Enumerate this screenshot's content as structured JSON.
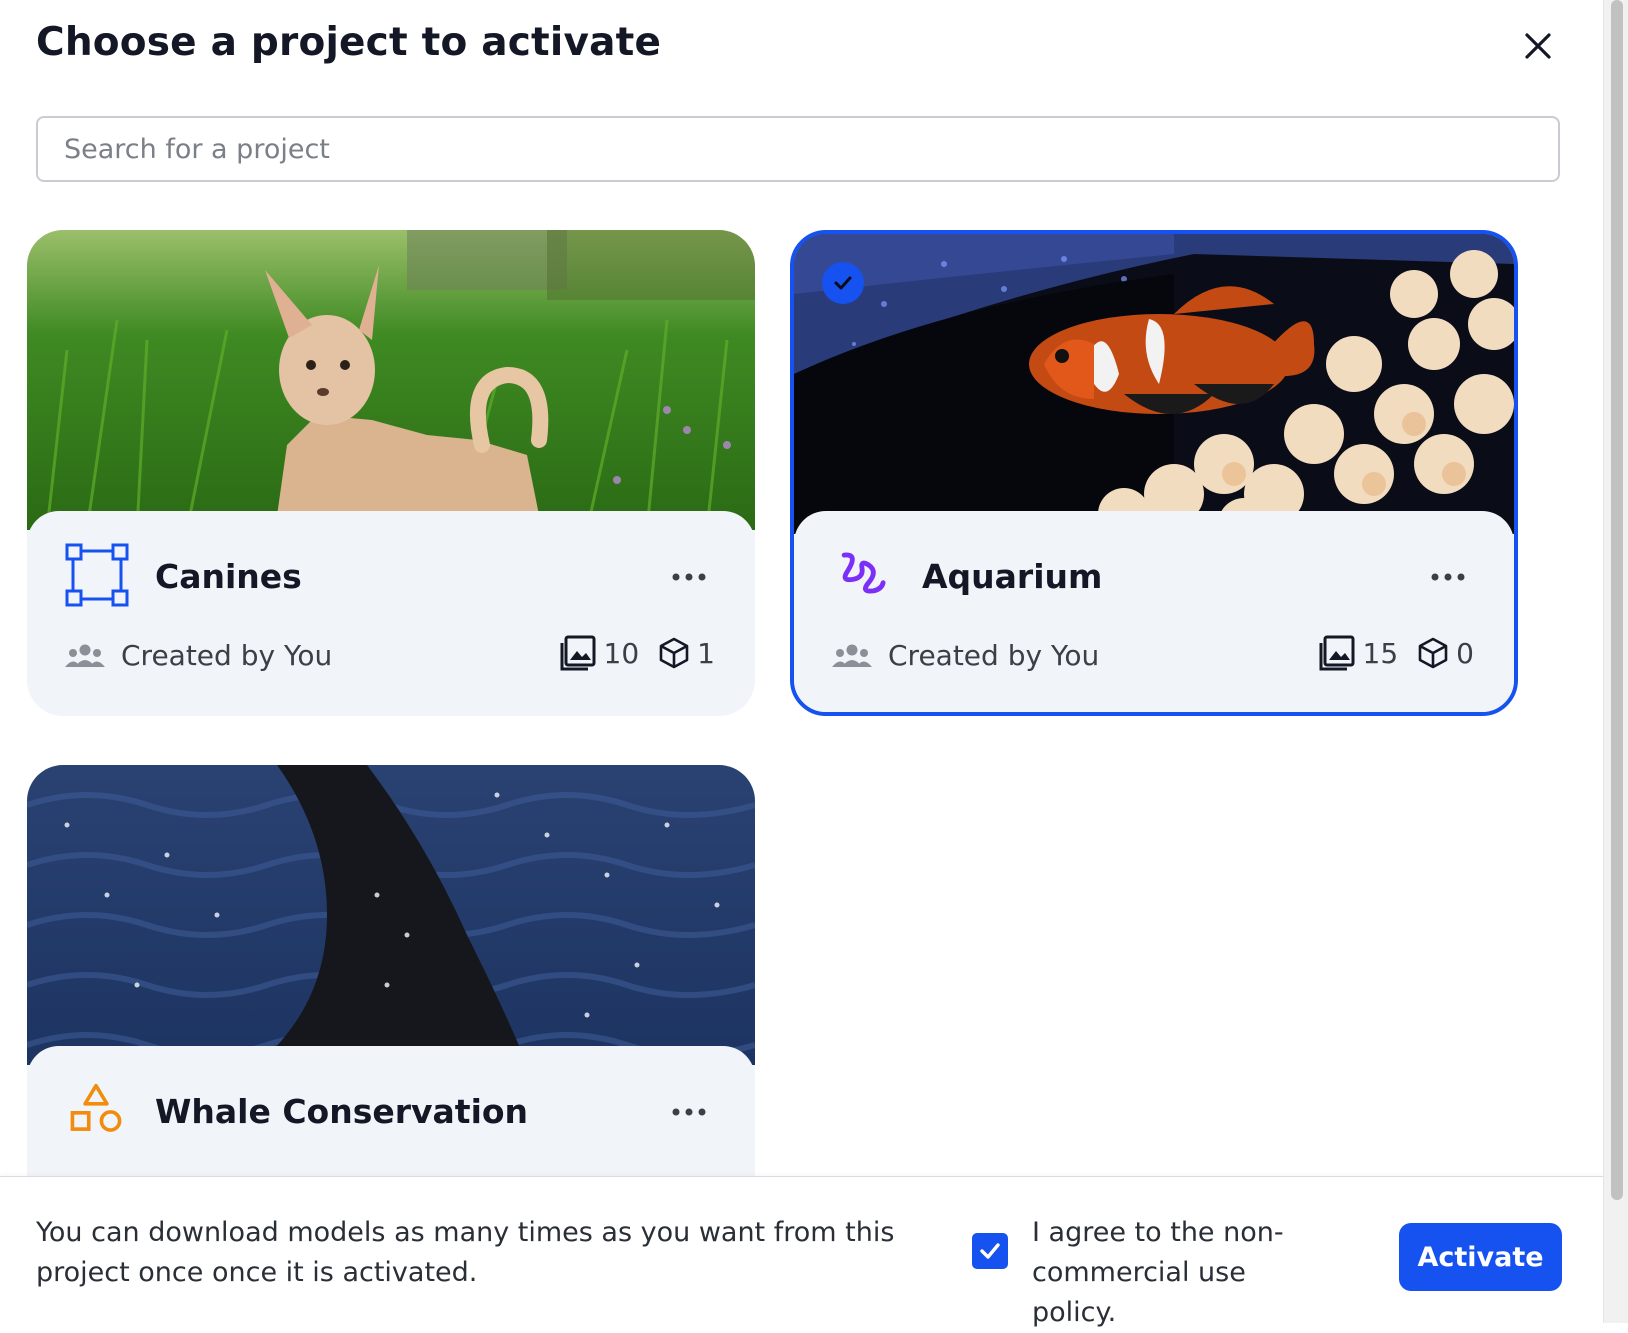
{
  "dialog": {
    "title": "Choose a project to activate",
    "close_icon": "close-icon"
  },
  "search": {
    "placeholder": "Search for a project",
    "value": ""
  },
  "projects": [
    {
      "name": "Canines",
      "icon": "bounding-box-icon",
      "icon_color": "#1652f0",
      "image": "chihuahua standing in grass",
      "creator": "Created by You",
      "image_count": "10",
      "model_count": "1",
      "selected": false
    },
    {
      "name": "Aquarium",
      "icon": "squiggle-icon",
      "icon_color": "#7b2ff7",
      "image": "clownfish near anemone",
      "creator": "Created by You",
      "image_count": "15",
      "model_count": "0",
      "selected": true
    },
    {
      "name": "Whale Conservation",
      "icon": "shapes-icon",
      "icon_color": "#f28c0f",
      "image": "orca dorsal fin in ocean",
      "creator": "",
      "image_count": "",
      "model_count": "",
      "selected": false
    }
  ],
  "footer": {
    "note": "You can download models as many times as you want from this project once once it is activated.",
    "agree_checked": true,
    "agree_text": "I agree to the non-commercial use policy.",
    "activate_label": "Activate"
  },
  "colors": {
    "accent": "#1652f0",
    "card_bg": "#f1f4f8",
    "text": "#141826"
  }
}
